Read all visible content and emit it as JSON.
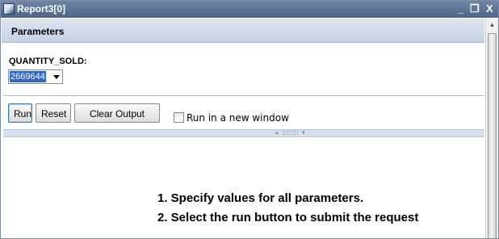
{
  "window": {
    "title": "Report3[0]",
    "minimize_glyph": "_",
    "restore_glyph": "❐",
    "close_glyph": "X"
  },
  "panel": {
    "header": "Parameters"
  },
  "parameter": {
    "label": "QUANTITY_SOLD:",
    "selected_value": "2669644"
  },
  "buttons": {
    "run": "Run",
    "reset": "Reset",
    "clear_output": "Clear Output"
  },
  "options": {
    "new_window_label": "Run in a new window",
    "new_window_checked": false
  },
  "splitter": {
    "grip": "▲ ¦¦¦¦¦¦¦¦ ▼"
  },
  "instructions": {
    "line1": "1. Specify values for all parameters.",
    "line2": "2. Select the run button to submit the request"
  },
  "icons": {
    "app": "report-app-icon",
    "scroll_up": "arrow-up-icon"
  },
  "colors": {
    "title_bar": "#5a7294",
    "panel_header": "#d1dbe8",
    "selection": "#3167c5"
  }
}
